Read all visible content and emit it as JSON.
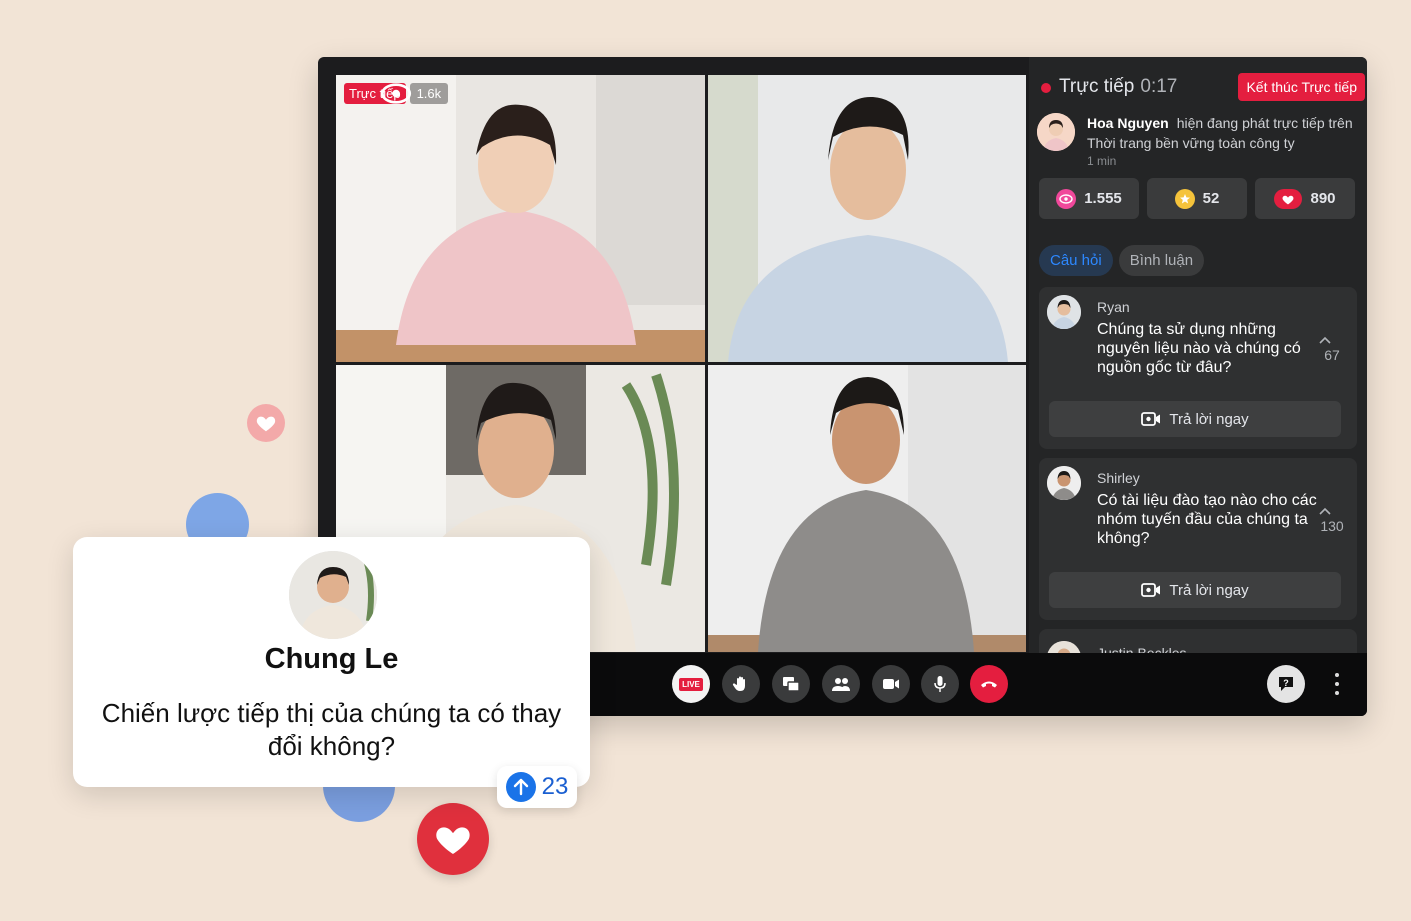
{
  "video": {
    "live_label": "Trực tiếp",
    "viewers": "1.6k"
  },
  "panel": {
    "title": "Trực tiếp",
    "timer": "0:17",
    "end_button": "Kết thúc Trực tiếp",
    "host": {
      "name": "Hoa Nguyen",
      "status": "hiện đang phát trực tiếp trên Thời trang bền vững toàn công ty",
      "time": "1 min"
    },
    "stats": [
      {
        "icon": "views-icon",
        "value": "1.555"
      },
      {
        "icon": "stars-icon",
        "value": "52"
      },
      {
        "icon": "reactions-icon",
        "value": "890"
      }
    ],
    "tabs": [
      {
        "label": "Câu hỏi",
        "active": true
      },
      {
        "label": "Bình luận",
        "active": false
      }
    ],
    "questions": [
      {
        "author": "Ryan",
        "text": "Chúng ta sử dụng những nguyên liệu nào và chúng có nguồn gốc từ đâu?",
        "votes": "67",
        "answer_label": "Trả lời ngay"
      },
      {
        "author": "Shirley",
        "text": "Có tài liệu đào tạo nào cho các nhóm tuyến đầu của chúng ta không?",
        "votes": "130",
        "answer_label": "Trả lời ngay"
      },
      {
        "author": "Justin Beckles"
      }
    ]
  },
  "toolbar": {
    "live_button": "LIVE"
  },
  "comment": {
    "name": "Chung Le",
    "text": "Chiến lược tiếp thị của chúng ta có thay đổi không?",
    "upvotes": "23"
  },
  "colors": {
    "background": "#f2e4d6",
    "live_red": "#e41e3f",
    "accent_blue": "#2d88ff",
    "panel": "#242526"
  }
}
